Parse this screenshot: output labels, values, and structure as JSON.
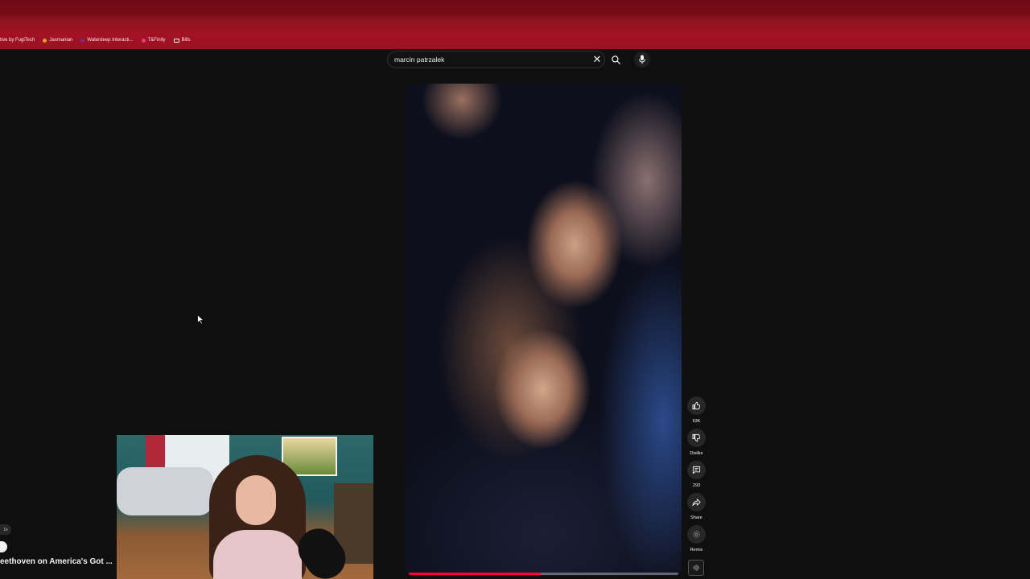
{
  "bookmarks": [
    {
      "label": "tive by FugiTech",
      "icon": "none"
    },
    {
      "label": "Jasmanian",
      "icon": "dot",
      "color": "#e0a020"
    },
    {
      "label": "Waterdeep Interacti...",
      "icon": "dot",
      "color": "#7a2a8a"
    },
    {
      "label": "T&Finity",
      "icon": "dot",
      "color": "#e83a7a"
    },
    {
      "label": "Bills",
      "icon": "folder"
    }
  ],
  "search": {
    "value": "marcin patrzalek",
    "placeholder": "Search"
  },
  "short": {
    "progress_fraction": 0.49,
    "actions": {
      "like_label": "63K",
      "dislike_label": "Dislike",
      "comments_label": "293",
      "share_label": "Share",
      "remix_label": "Remix"
    }
  },
  "sidebar": {
    "video_title": "eethoven on America's Got ...",
    "mini_label": "1x"
  },
  "colors": {
    "accent": "#ff0033",
    "browser_chrome": "#a01224",
    "background": "#0f0f0f"
  }
}
